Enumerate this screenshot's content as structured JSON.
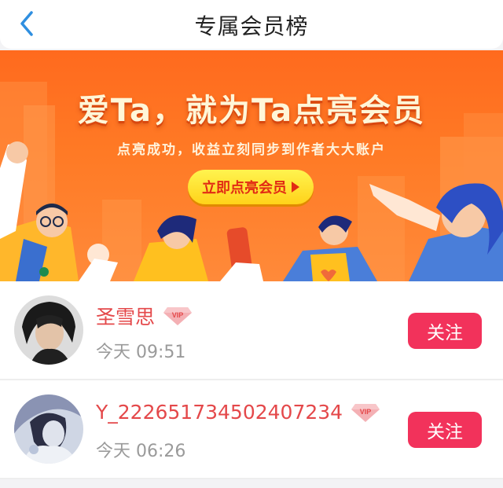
{
  "header": {
    "title": "专属会员榜",
    "back_icon": "chevron-left-icon"
  },
  "banner": {
    "headline": "爱Ta，就为Ta点亮会员",
    "subtitle": "点亮成功，收益立刻同步到作者大大账户",
    "cta_label": "立即点亮会员"
  },
  "members": [
    {
      "name": "圣雪思",
      "badge": "VIP",
      "time": "今天 09:51",
      "follow_label": "关注"
    },
    {
      "name": "Y_222651734502407234",
      "badge": "VIP",
      "time": "今天 06:26",
      "follow_label": "关注"
    }
  ],
  "colors": {
    "accent": "#f2325b",
    "name": "#e4484a",
    "banner": "#ff7a25",
    "cta": "#ffe23a"
  }
}
